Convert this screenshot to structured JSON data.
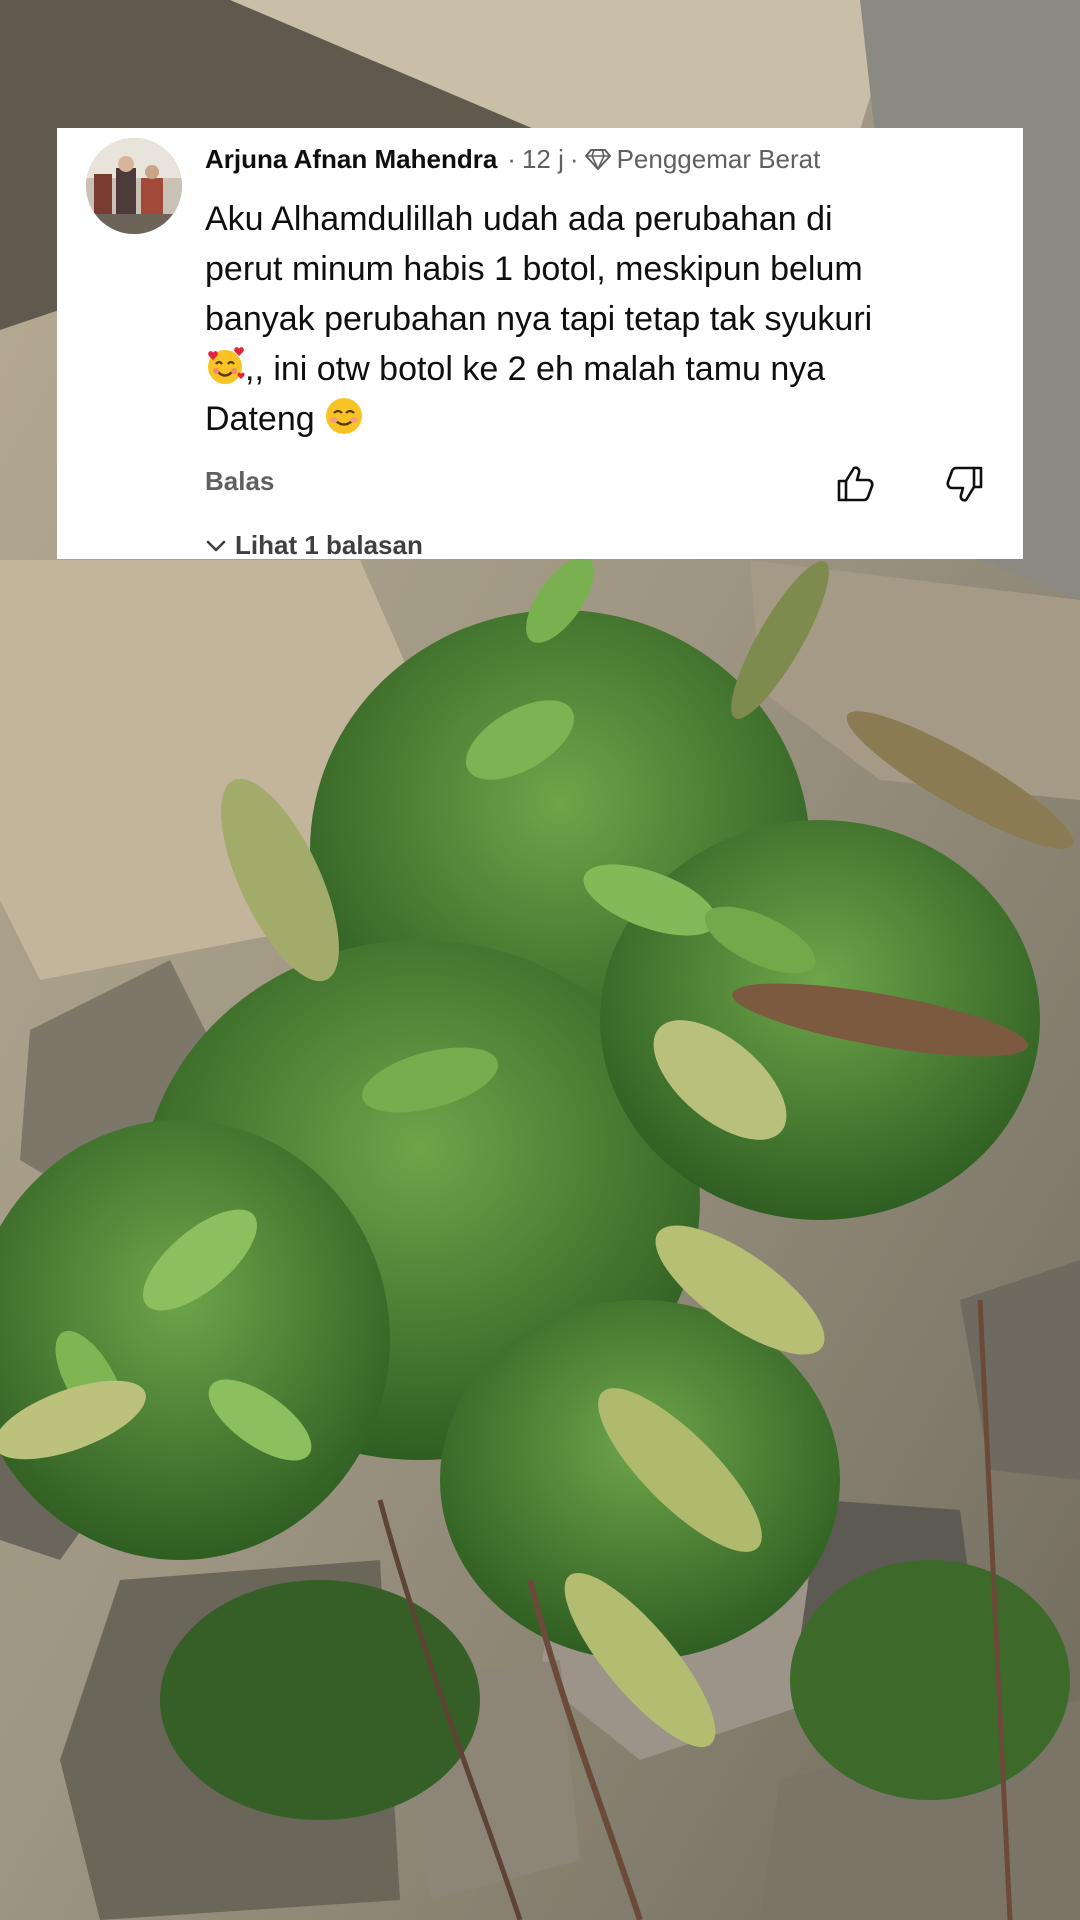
{
  "comment": {
    "author": "Arjuna Afnan Mahendra",
    "time": "12 j",
    "badge_label": "Penggemar Berat",
    "separator": "·",
    "body_lines": [
      "Aku Alhamdulillah udah ada perubahan di",
      "perut minum habis 1 botol, meskipun belum",
      "banyak perubahan nya tapi tetap tak syukuri",
      ",, ini otw botol ke 2 eh malah tamu nya",
      "Dateng"
    ],
    "reply_label": "Balas",
    "view_replies_label": "Lihat 1 balasan"
  },
  "icons": {
    "badge": "diamond-icon",
    "like": "thumbs-up-icon",
    "dislike": "thumbs-down-icon",
    "expand": "chevron-down-icon",
    "emoji_1": "smiling-face-with-hearts-emoji",
    "emoji_2": "smiling-face-emoji"
  },
  "colors": {
    "card_background": "#ffffff",
    "primary_text": "#0f0f0f",
    "secondary_text": "#606060"
  }
}
